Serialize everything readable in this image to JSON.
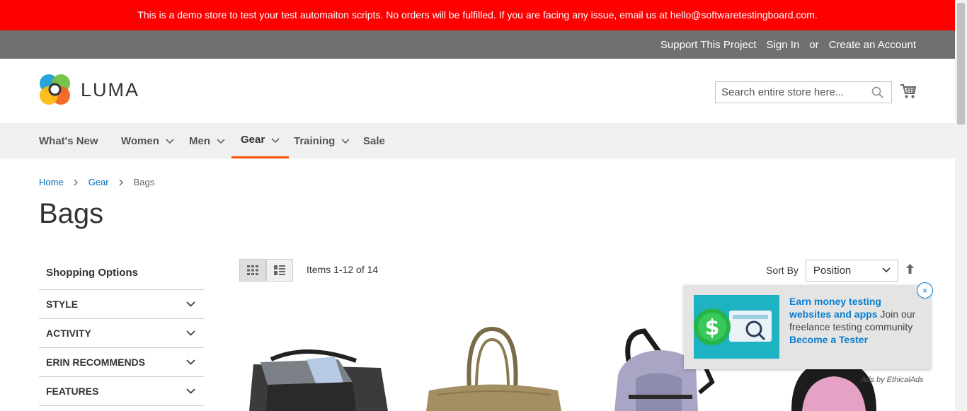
{
  "demo_notice": "This is a demo store to test your test automaiton scripts. No orders will be fulfilled. If you are facing any issue, email us at hello@softwaretestingboard.com.",
  "top_links": {
    "support": "Support This Project",
    "sign_in": "Sign In",
    "or": "or",
    "create_account": "Create an Account"
  },
  "logo": {
    "text": "LUMA"
  },
  "search": {
    "placeholder": "Search entire store here..."
  },
  "nav": [
    {
      "label": "What's New"
    },
    {
      "label": "Women"
    },
    {
      "label": "Men"
    },
    {
      "label": "Gear"
    },
    {
      "label": "Training"
    },
    {
      "label": "Sale"
    }
  ],
  "breadcrumbs": {
    "home": "Home",
    "gear": "Gear",
    "current": "Bags"
  },
  "page_title": "Bags",
  "sidebar": {
    "title": "Shopping Options",
    "filters": [
      "STYLE",
      "ACTIVITY",
      "ERIN RECOMMENDS",
      "FEATURES"
    ]
  },
  "toolbar": {
    "amount": "Items 1-12 of 14",
    "sort_label": "Sort By",
    "sort_value": "Position"
  },
  "ad": {
    "headline": "Earn money testing websites and apps",
    "body": " Join our freelance testing community ",
    "cta": "Become a Tester",
    "credit": "Ads by EthicalAds",
    "close": "×"
  },
  "colors": {
    "demo_bar": "#ff0000",
    "top_bar": "#6e716e",
    "nav_active_underline": "#ff5501",
    "link": "#006bb4"
  }
}
